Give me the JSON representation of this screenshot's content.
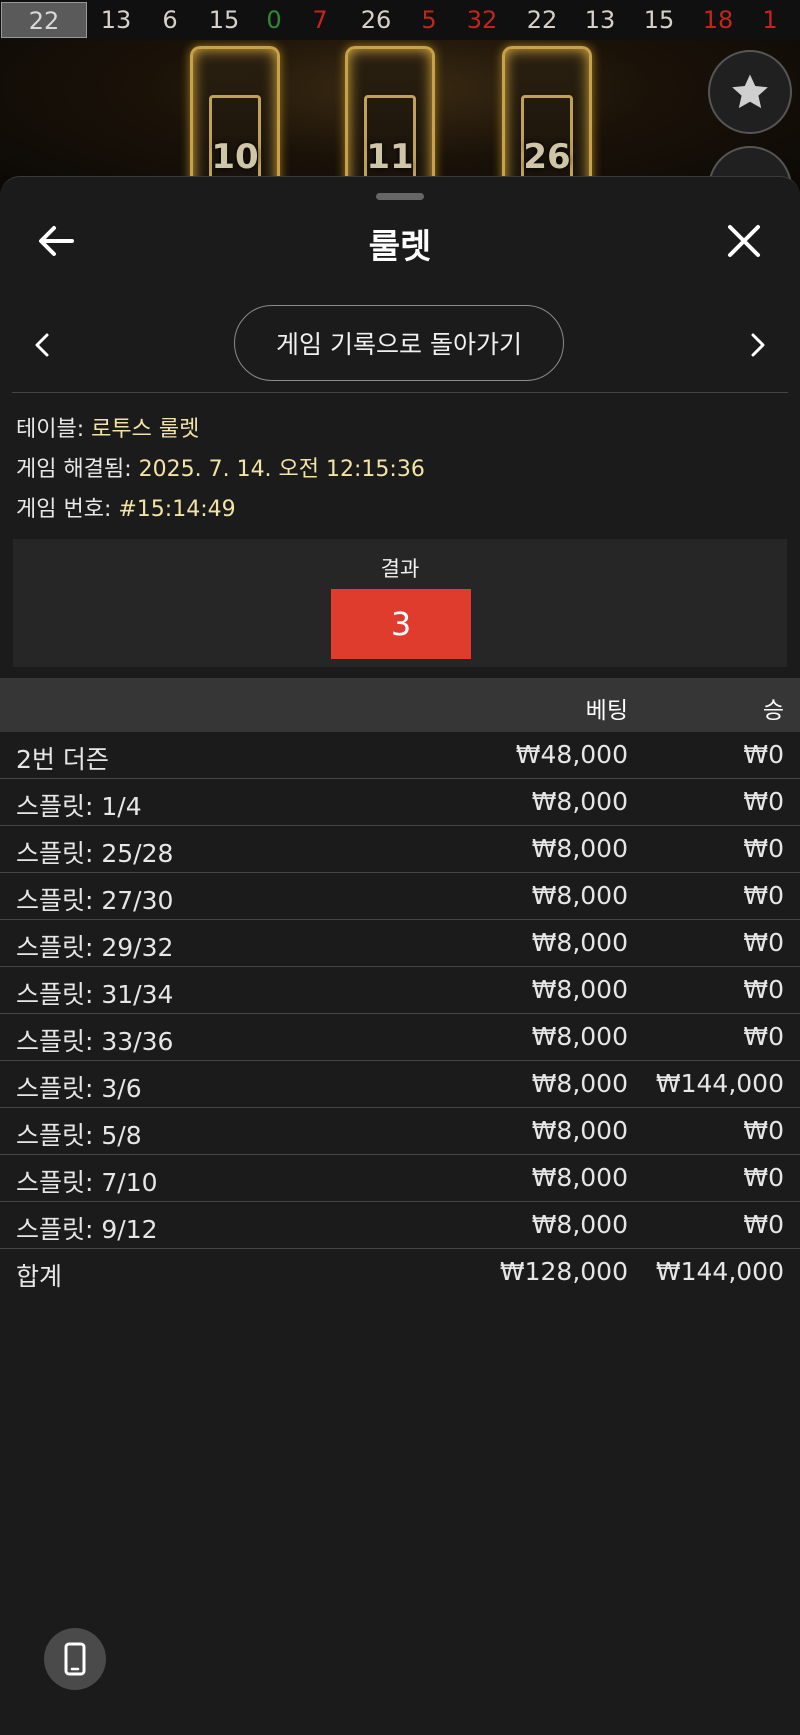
{
  "history": [
    {
      "n": "22",
      "color": "#d8d8d8"
    },
    {
      "n": "13",
      "color": "#d6d0c8"
    },
    {
      "n": "6",
      "color": "#d6d0c8"
    },
    {
      "n": "15",
      "color": "#d6d0c8"
    },
    {
      "n": "0",
      "color": "#2f8a2f"
    },
    {
      "n": "7",
      "color": "#c0261c"
    },
    {
      "n": "26",
      "color": "#d6d0c8"
    },
    {
      "n": "5",
      "color": "#c0261c"
    },
    {
      "n": "32",
      "color": "#c0261c"
    },
    {
      "n": "22",
      "color": "#d6d0c8"
    },
    {
      "n": "13",
      "color": "#d6d0c8"
    },
    {
      "n": "15",
      "color": "#d6d0c8"
    },
    {
      "n": "18",
      "color": "#c0261c"
    },
    {
      "n": "1",
      "color": "#c0261c"
    }
  ],
  "game": {
    "pillars": [
      "10",
      "11",
      "26"
    ]
  },
  "sheet": {
    "title": "룰렛",
    "back_to_history": "게임 기록으로 돌아가기"
  },
  "info": {
    "table_label": "테이블: ",
    "table_value": "로투스 룰렛",
    "resolved_label": "게임 해결됨: ",
    "resolved_value": "2025. 7. 14. 오전 12:15:36",
    "number_label": "게임 번호: ",
    "number_value": "#15:14:49"
  },
  "result": {
    "label": "결과",
    "value": "3",
    "color": "#e03c2e"
  },
  "bets_table": {
    "col_bet": "베팅",
    "col_win": "승",
    "rows": [
      {
        "name": "2번 더즌",
        "bet": "₩48,000",
        "win": "₩0"
      },
      {
        "name": "스플릿: 1/4",
        "bet": "₩8,000",
        "win": "₩0"
      },
      {
        "name": "스플릿: 25/28",
        "bet": "₩8,000",
        "win": "₩0"
      },
      {
        "name": "스플릿: 27/30",
        "bet": "₩8,000",
        "win": "₩0"
      },
      {
        "name": "스플릿: 29/32",
        "bet": "₩8,000",
        "win": "₩0"
      },
      {
        "name": "스플릿: 31/34",
        "bet": "₩8,000",
        "win": "₩0"
      },
      {
        "name": "스플릿: 33/36",
        "bet": "₩8,000",
        "win": "₩0"
      },
      {
        "name": "스플릿: 3/6",
        "bet": "₩8,000",
        "win": "₩144,000"
      },
      {
        "name": "스플릿: 5/8",
        "bet": "₩8,000",
        "win": "₩0"
      },
      {
        "name": "스플릿: 7/10",
        "bet": "₩8,000",
        "win": "₩0"
      },
      {
        "name": "스플릿: 9/12",
        "bet": "₩8,000",
        "win": "₩0"
      }
    ],
    "total": {
      "name": "합계",
      "bet": "₩128,000",
      "win": "₩144,000"
    }
  },
  "icons": {
    "favorite": "star-icon",
    "back": "arrow-left-icon",
    "close": "close-icon",
    "prev": "chevron-left-icon",
    "next": "chevron-right-icon",
    "device": "mobile-device-icon"
  }
}
